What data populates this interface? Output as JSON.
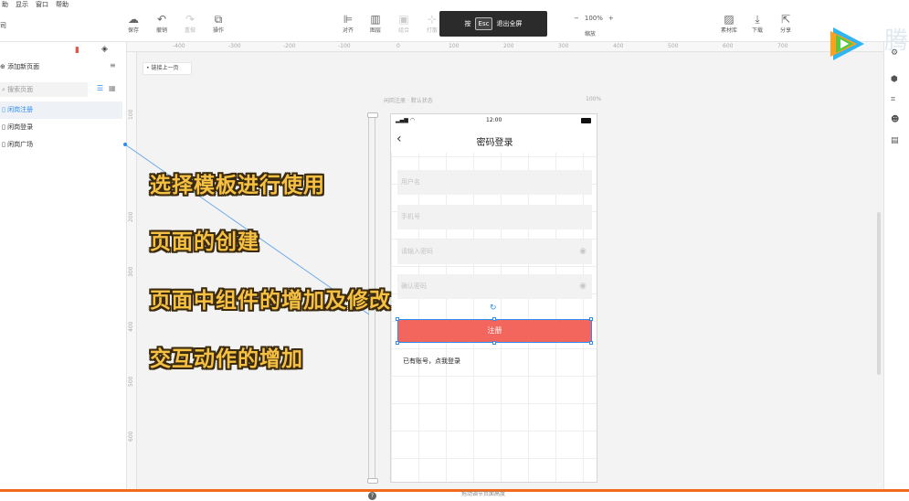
{
  "menubar": [
    "助",
    "显示",
    "窗口",
    "帮助"
  ],
  "toolbar": {
    "left_label": "司",
    "items": [
      {
        "key": "save",
        "label": "保存",
        "icon": "upload-cloud-icon",
        "disabled": false
      },
      {
        "key": "undo",
        "label": "撤销",
        "icon": "undo-icon",
        "disabled": false
      },
      {
        "key": "redo",
        "label": "重做",
        "icon": "redo-icon",
        "disabled": true
      },
      {
        "key": "operate",
        "label": "操作",
        "icon": "copy-icon",
        "disabled": false
      },
      {
        "key": "align",
        "label": "对齐",
        "icon": "align-icon",
        "disabled": false
      },
      {
        "key": "layer",
        "label": "图层",
        "icon": "layer-icon",
        "disabled": false
      },
      {
        "key": "group",
        "label": "组合",
        "icon": "group-icon",
        "disabled": true
      },
      {
        "key": "ungroup",
        "label": "打散",
        "icon": "ungroup-icon",
        "disabled": true
      },
      {
        "key": "library",
        "label": "素材库",
        "icon": "image-icon",
        "disabled": false
      },
      {
        "key": "download",
        "label": "下载",
        "icon": "download-icon",
        "disabled": false
      },
      {
        "key": "share",
        "label": "分享",
        "icon": "share-icon",
        "disabled": false
      }
    ],
    "zoom": {
      "minus": "−",
      "value": "100%",
      "plus": "+",
      "label": "缩放"
    }
  },
  "fullscreen_tip": {
    "prefix": "按",
    "key": "Esc",
    "suffix": "退出全屏"
  },
  "logo_text": "腾",
  "left_panel": {
    "add_page": "添加新页面",
    "search_placeholder": "搜索页面",
    "pages": [
      {
        "label": "闲岗注册",
        "active": true
      },
      {
        "label": "闲岗登录",
        "active": false
      },
      {
        "label": "闲岗广场",
        "active": false
      }
    ]
  },
  "ruler": {
    "h_ticks": [
      "-400",
      "-300",
      "-200",
      "-100",
      "0",
      "100",
      "200",
      "300",
      "400",
      "500",
      "600",
      "700"
    ],
    "v_ticks": [
      "100",
      "200",
      "300",
      "400",
      "500",
      "600"
    ]
  },
  "canvas": {
    "link_prev": "链接上一页",
    "frame_label": "闲岗注册 · 默认状态",
    "frame_zoom": "100%"
  },
  "phone": {
    "time": "12:00",
    "title": "密码登录",
    "fields": [
      {
        "placeholder": "用户名",
        "eye": false
      },
      {
        "placeholder": "手机号",
        "eye": false
      },
      {
        "placeholder": "请输入密码",
        "eye": true
      },
      {
        "placeholder": "确认密码",
        "eye": true
      }
    ],
    "register_button": "注册",
    "login_link": "已有账号，点我登录"
  },
  "captions": [
    "选择模板进行使用",
    "页面的创建",
    "页面中组件的增加及修改",
    "交互动作的增加"
  ],
  "bottom_hint": "拖动调节页面高度",
  "help_icon": "?",
  "colors": {
    "accent": "#2d8cf0",
    "register_button": "#f3665d",
    "caption": "#f6c142",
    "progress": "#f26b1d"
  }
}
